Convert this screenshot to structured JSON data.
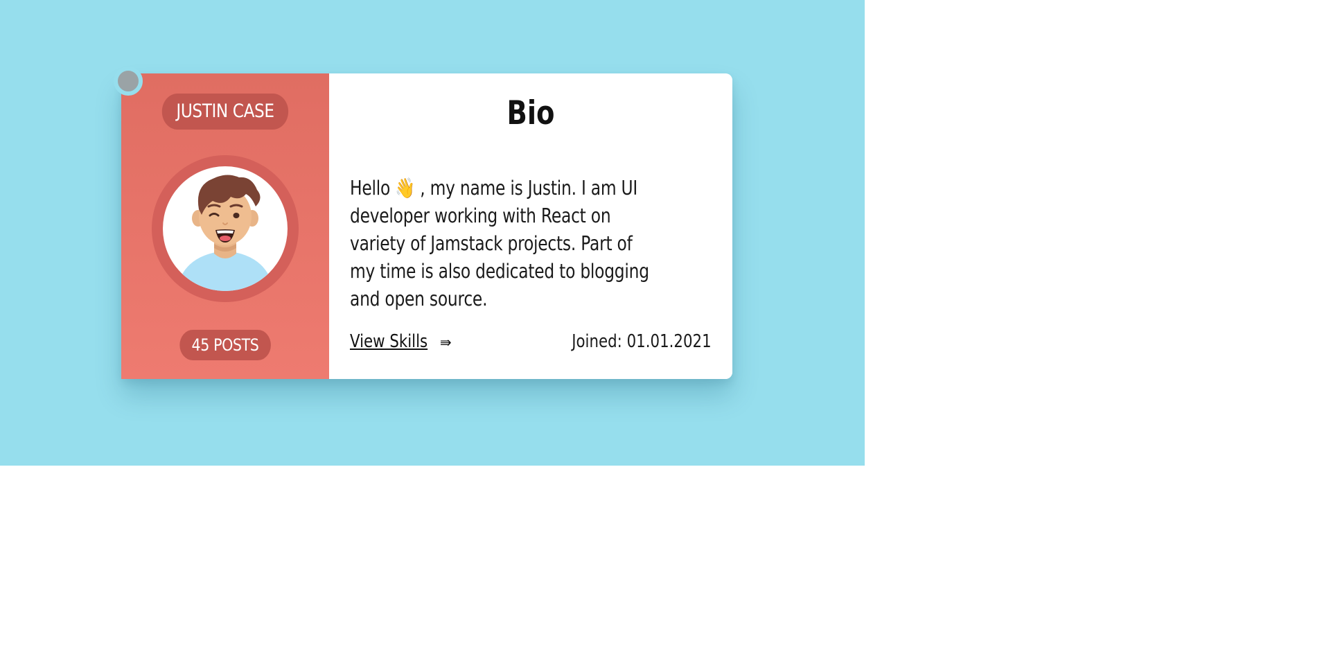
{
  "profile": {
    "name": "JUSTIN CASE",
    "posts": "45 POSTS",
    "avatar_icon": "cartoon-boy-avatar"
  },
  "bio": {
    "title": "Bio",
    "text": "Hello 👋 , my name is Justin. I am UI developer working with React on variety of Jamstack projects. Part of my time is also dedicated to blogging and open source.",
    "skills_link": "View Skills",
    "skills_arrow": "⇛",
    "joined": "Joined: 01.01.2021"
  },
  "colors": {
    "background": "#96deed",
    "card_left": "#e06d62",
    "pill": "#c2564f",
    "corner_dot": "#9aa3a6"
  }
}
